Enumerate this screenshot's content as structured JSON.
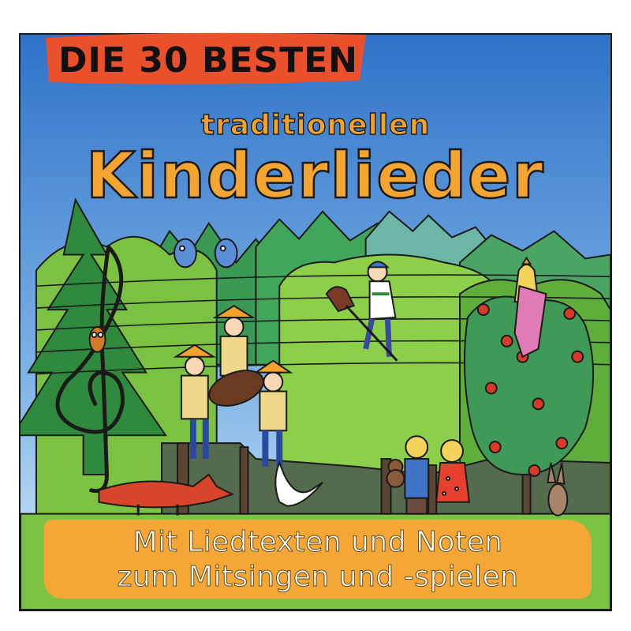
{
  "badge": {
    "text": "DIE 30 BESTEN"
  },
  "subtitle": "traditionellen",
  "title": "Kinderlieder",
  "banner": {
    "line1": "Mit Liedtexten und Noten",
    "line2": "zum Mitsingen und -spielen"
  },
  "colors": {
    "sky": "#3d7fd0",
    "badge": "#e9502b",
    "title": "#f4a430",
    "banner": "#f4a636",
    "forest": "#3f8f3c",
    "meadow": "#8cc63f"
  },
  "illustration": {
    "elements": [
      "treble-clef",
      "pine-trees",
      "owl",
      "two-birds",
      "three-children-with-cello",
      "boy-on-hobby-horse",
      "princess-in-rose-bush",
      "fox",
      "goose",
      "two-children-with-teddy",
      "rabbit",
      "music-staff-lines"
    ]
  }
}
